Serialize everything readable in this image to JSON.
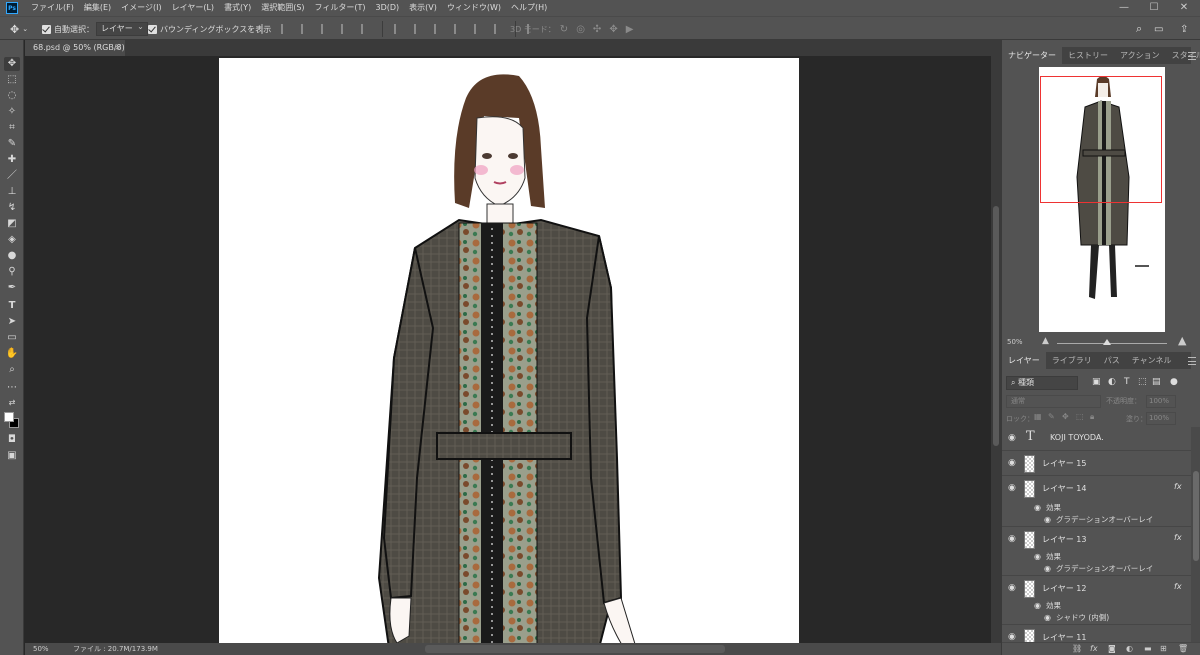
{
  "app": {
    "logo": "Ps"
  },
  "menu": [
    "ファイル(F)",
    "編集(E)",
    "イメージ(I)",
    "レイヤー(L)",
    "書式(Y)",
    "選択範囲(S)",
    "フィルター(T)",
    "3D(D)",
    "表示(V)",
    "ウィンドウ(W)",
    "ヘルプ(H)"
  ],
  "window_controls": {
    "minimize": "—",
    "maximize": "☐",
    "close": "✕"
  },
  "options": {
    "auto_select_label": "自動選択：",
    "auto_select_value": "レイヤー",
    "bounding_box_label": "バウンディングボックスを表示",
    "mode_3d_label": "3D モード："
  },
  "document": {
    "tab_label": "68.psd @ 50% (RGB/8)",
    "tab_close": "×",
    "zoom": "50%",
    "file_info": "ファイル : 20.7M/173.9M"
  },
  "panels": {
    "top_tabs": [
      "ナビゲーター",
      "ヒストリー",
      "アクション",
      "スタイル"
    ],
    "navigator_zoom": "50%",
    "layer_tabs": [
      "レイヤー",
      "ライブラリ",
      "パス",
      "チャンネル"
    ],
    "kind_filter": "種類",
    "blend_mode": "通常",
    "opacity_label": "不透明度：",
    "opacity_value": "100%",
    "lock_label": "ロック：",
    "fill_label": "塗り：",
    "fill_value": "100%"
  },
  "layers": [
    {
      "name": "KOJI TOYODA.",
      "type": "text"
    },
    {
      "name": "レイヤー 15",
      "type": "pixel"
    },
    {
      "name": "レイヤー 14",
      "type": "pixel",
      "fx": true,
      "effects_label": "効果",
      "effect": "グラデーションオーバーレイ"
    },
    {
      "name": "レイヤー 13",
      "type": "pixel",
      "fx": true,
      "effects_label": "効果",
      "effect": "グラデーションオーバーレイ"
    },
    {
      "name": "レイヤー 12",
      "type": "pixel",
      "fx": true,
      "effects_label": "効果",
      "effect": "シャドウ (内側)"
    },
    {
      "name": "レイヤー 11",
      "type": "pixel"
    }
  ],
  "fx_badge": "fx",
  "colors": {
    "chrome": "#535353",
    "canvas_bg": "#282828",
    "nav_frame": "#ee3333"
  }
}
